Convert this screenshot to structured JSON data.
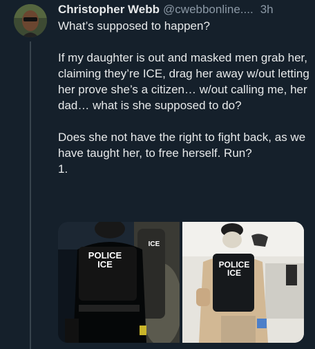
{
  "tweet": {
    "author_name": "Christopher Webb",
    "handle": "@cwebbonline....",
    "time": "3h",
    "paragraphs": [
      "What’s supposed to happen?",
      "If my daughter is out and masked men grab her, claiming they’re ICE, drag her away w/out letting her prove she’s a citizen… w/out calling me, her dad… what is she supposed to do?",
      "Does she not have the right to fight back, as we have taught her, to free herself. Run?",
      "1."
    ]
  },
  "media": {
    "image1": {
      "vest_line1": "POLICE",
      "vest_line2": "ICE",
      "vest_partial": "ICE"
    },
    "image2": {
      "vest_line1": "POLICE",
      "vest_line2": "ICE"
    }
  },
  "colors": {
    "background": "#15202b",
    "text": "#e7e9ea",
    "secondary": "#8b98a5"
  }
}
